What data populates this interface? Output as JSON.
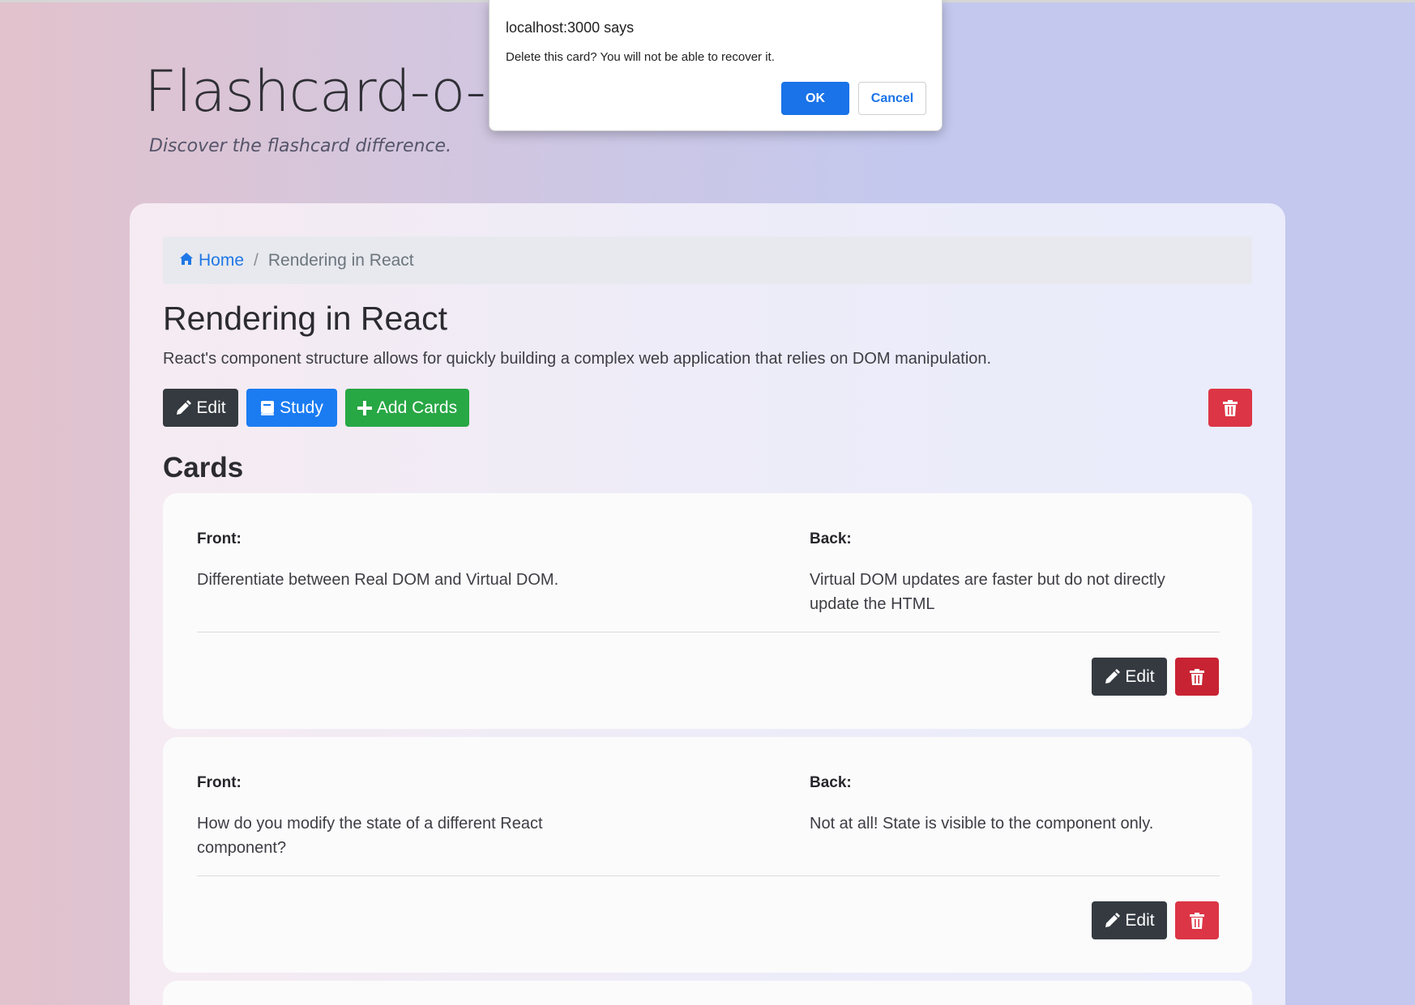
{
  "header": {
    "title": "Flashcard-o-m",
    "subtitle": "Discover the flashcard difference."
  },
  "breadcrumb": {
    "home_label": "Home",
    "separator": "/",
    "current": "Rendering in React"
  },
  "deck": {
    "title": "Rendering in React",
    "description": "React's component structure allows for quickly building a complex web application that relies on DOM manipulation.",
    "edit_label": "Edit",
    "study_label": "Study",
    "add_cards_label": "Add Cards"
  },
  "cards_heading": "Cards",
  "cards": [
    {
      "front_label": "Front:",
      "front": "Differentiate between Real DOM and Virtual DOM.",
      "back_label": "Back:",
      "back": "Virtual DOM updates are faster but do not directly update the HTML",
      "edit_label": "Edit"
    },
    {
      "front_label": "Front:",
      "front": "How do you modify the state of a different React component?",
      "back_label": "Back:",
      "back": "Not at all! State is visible to the component only.",
      "edit_label": "Edit"
    }
  ],
  "dialog": {
    "title": "localhost:3000 says",
    "message": "Delete this card? You will not be able to recover it.",
    "ok_label": "OK",
    "cancel_label": "Cancel"
  },
  "colors": {
    "primary": "#1b7cf2",
    "success": "#28a745",
    "danger": "#dc3545",
    "dark": "#343a40",
    "dialog_primary": "#1a73e8"
  },
  "icons": [
    "home-icon",
    "pencil-icon",
    "book-icon",
    "plus-icon",
    "trash-icon"
  ]
}
